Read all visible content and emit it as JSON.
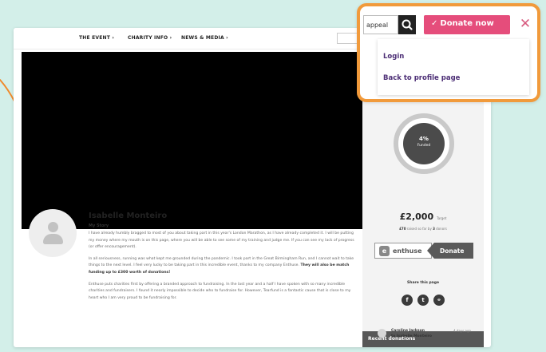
{
  "nav": {
    "event": "THE EVENT",
    "charity": "CHARITY INFO",
    "news": "NEWS & MEDIA"
  },
  "story": {
    "name": "Isabelle Monteiro",
    "heading": "My Story",
    "p1": "I have already humbly bragged to most of you about taking part in this year's London Marathon, as I have already completed it. I will be putting my money where my mouth is on this page, where you will be able to see some of my training and judge me. If you can see my lack of progress (or offer encouragement).",
    "p2": "In all seriousness, running was what kept me grounded during the pandemic. I took part in the Great Birmingham Run, and I cannot wait to take things to the next level. I feel very lucky to be taking part in this incredible event, thanks to my company Enthuse.",
    "p2_bold": "They will also be match funding up to £300 worth of donations!",
    "p3": "Enthuse puts charities first by offering a branded approach to fundraising. In the last year and a half I have spoken with so many incredible charities and fundraisers. I found it nearly impossible to decide who to fundraise for. However, Tearfund is a fantastic cause that is close to my heart who I am very proud to be fundraising for."
  },
  "progress": {
    "percent": "4%",
    "funded_label": "Funded",
    "percent_value": 0.04,
    "target": "£2,000",
    "target_label": "Target",
    "raised": "£70",
    "raised_label": "raised so far by",
    "donor_count": "3",
    "donors_label": "donors"
  },
  "donate_bar": {
    "brand": "enthuse",
    "action": "Donate"
  },
  "share": {
    "label": "Share this page"
  },
  "recent": {
    "heading": "Recent donations",
    "donor": "Caroline Jackson",
    "to": "to Isabelle Monteiro",
    "time": "4 days ago"
  },
  "overlay": {
    "search_value": "appeal",
    "donate_label": "Donate now",
    "menu": [
      "Login",
      "Back to profile page"
    ]
  },
  "colors": {
    "background": "#d3efe9",
    "donate_pink": "#e54d7b",
    "highlight_orange": "#f19a3b",
    "menu_purple": "#4d2f76"
  }
}
